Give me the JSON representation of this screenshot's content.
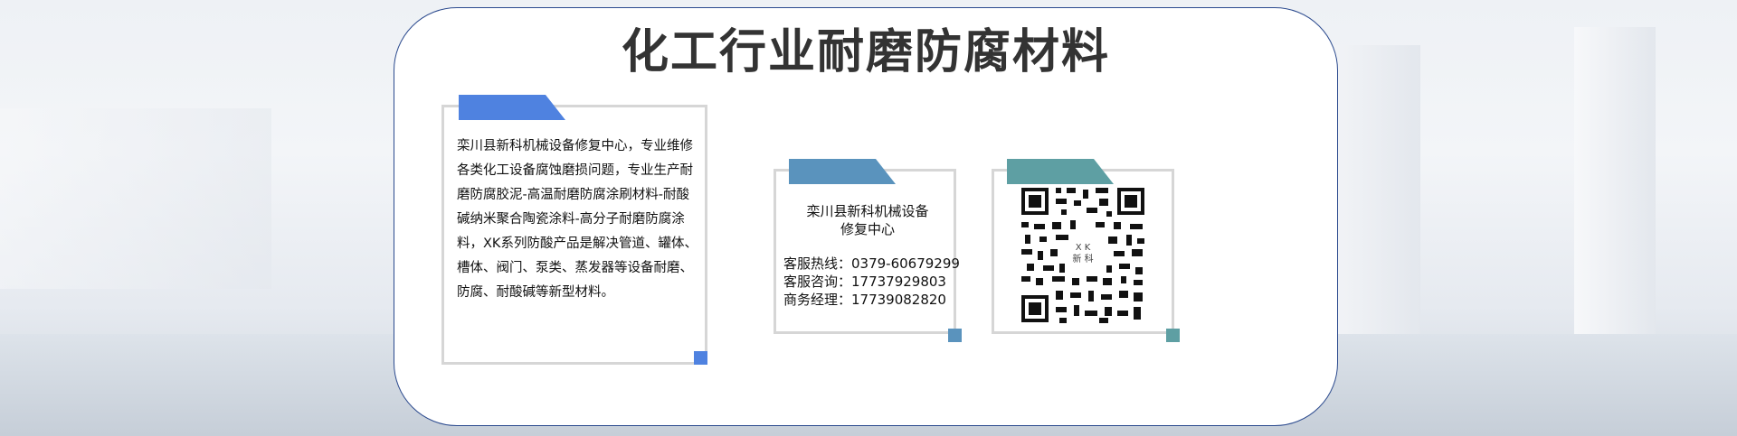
{
  "title": "化工行业耐磨防腐材料",
  "description": "栾川县新科机械设备修复中心，专业维修各类化工设备腐蚀磨损问题，专业生产耐磨防腐胶泥-高温耐磨防腐涂刷材料-耐酸碱纳米聚合陶瓷涂料-高分子耐磨防腐涂料，XK系列防酸产品是解决管道、罐体、槽体、阀门、泵类、蒸发器等设备耐磨、防腐、耐酸碱等新型材料。",
  "contact": {
    "company_line1": "栾川县新科机械设备",
    "company_line2": "修复中心",
    "hotline": "客服热线：0379-60679299",
    "consult": "客服咨询：17737929803",
    "manager": "商务经理：17739082820"
  },
  "qr_logo": {
    "line1": "X K",
    "line2": "新 科"
  },
  "colors": {
    "tab1": "#4f82e0",
    "tab2": "#5a93bd",
    "tab3": "#5e9fa3",
    "border": "#2b4a8e"
  }
}
